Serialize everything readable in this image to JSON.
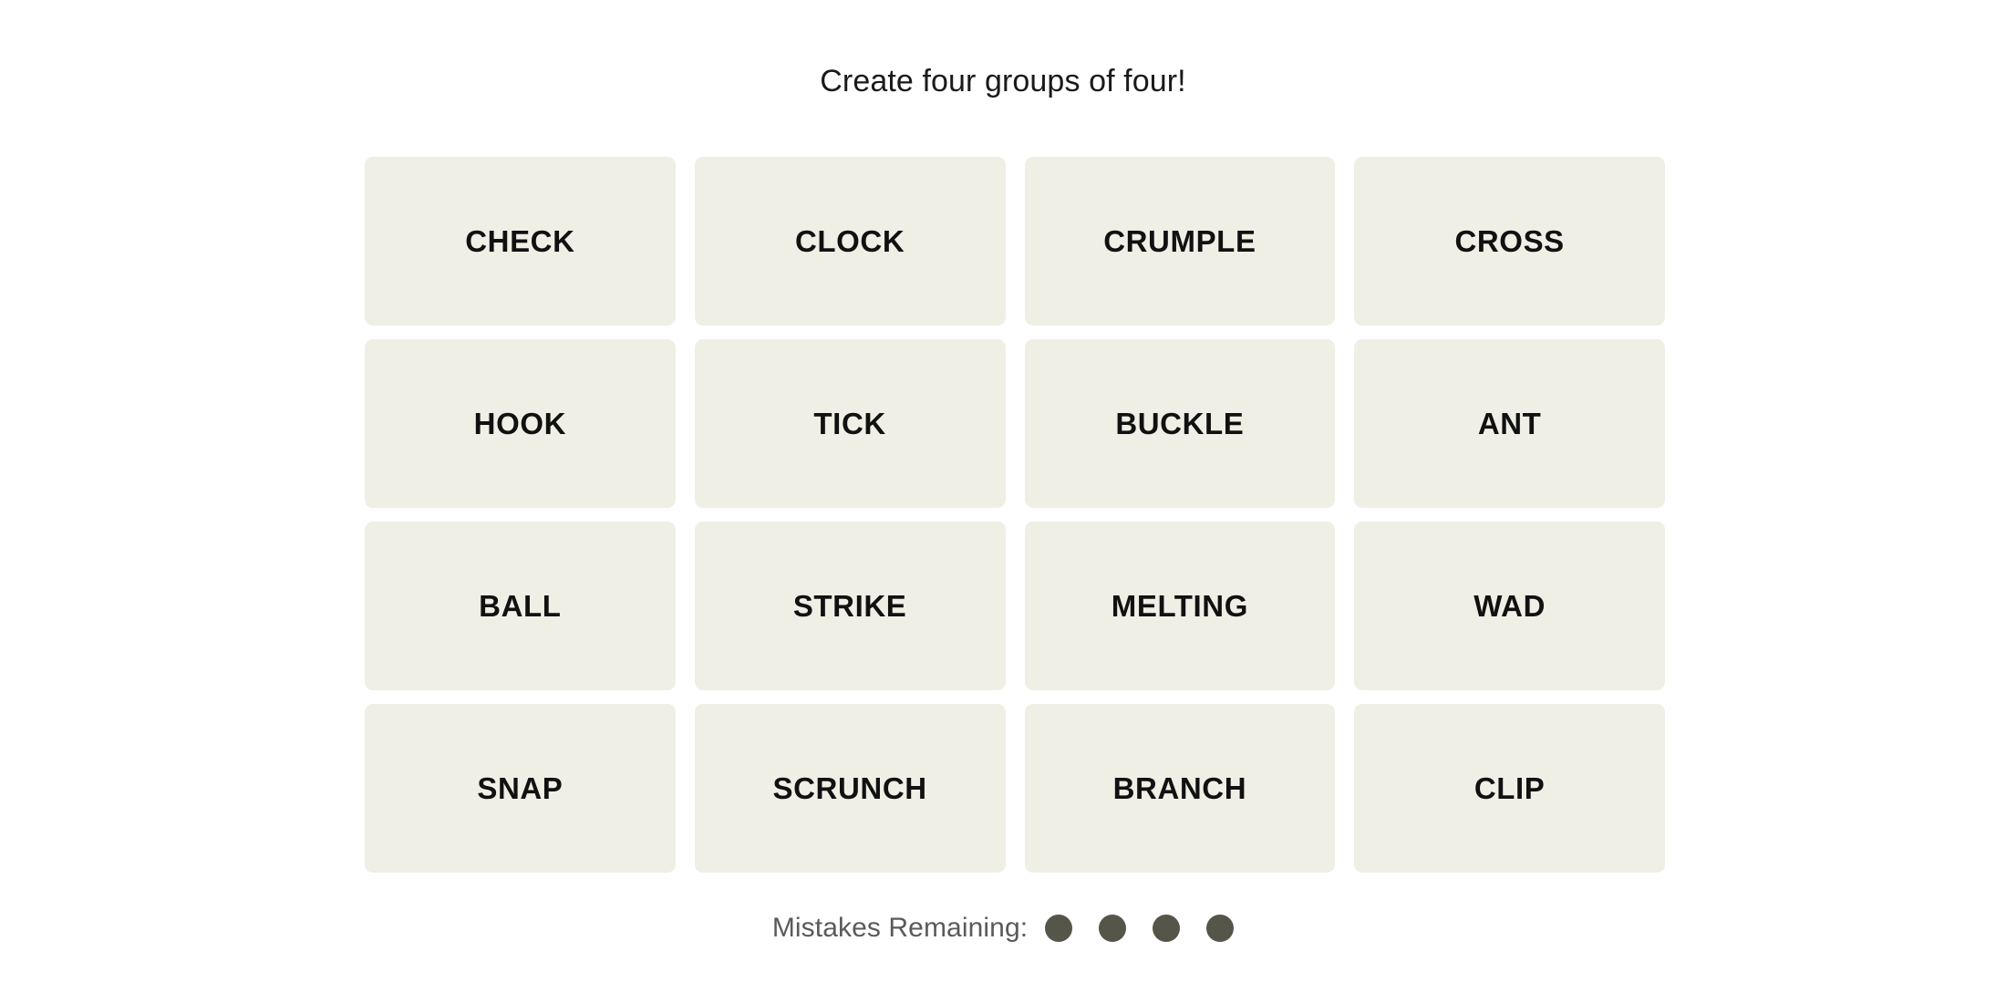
{
  "page": {
    "background_color": "#FFFFFF"
  },
  "header": {
    "prompt": "Create four groups of four!",
    "prompt_color": "#1A1A1A"
  },
  "board": {
    "rows": 4,
    "columns": 4,
    "tile_background_color": "#EFEFE6",
    "tile_text_color": "#111111",
    "tiles": [
      {
        "label": "CHECK"
      },
      {
        "label": "CLOCK"
      },
      {
        "label": "CRUMPLE"
      },
      {
        "label": "CROSS"
      },
      {
        "label": "HOOK"
      },
      {
        "label": "TICK"
      },
      {
        "label": "BUCKLE"
      },
      {
        "label": "ANT"
      },
      {
        "label": "BALL"
      },
      {
        "label": "STRIKE"
      },
      {
        "label": "MELTING"
      },
      {
        "label": "WAD"
      },
      {
        "label": "SNAP"
      },
      {
        "label": "SCRUNCH"
      },
      {
        "label": "BRANCH"
      },
      {
        "label": "CLIP"
      }
    ]
  },
  "mistakes": {
    "label": "Mistakes Remaining:",
    "label_color": "#5A5A5A",
    "remaining": 4,
    "dot_color": "#55554A",
    "dots": [
      1,
      2,
      3,
      4
    ]
  }
}
